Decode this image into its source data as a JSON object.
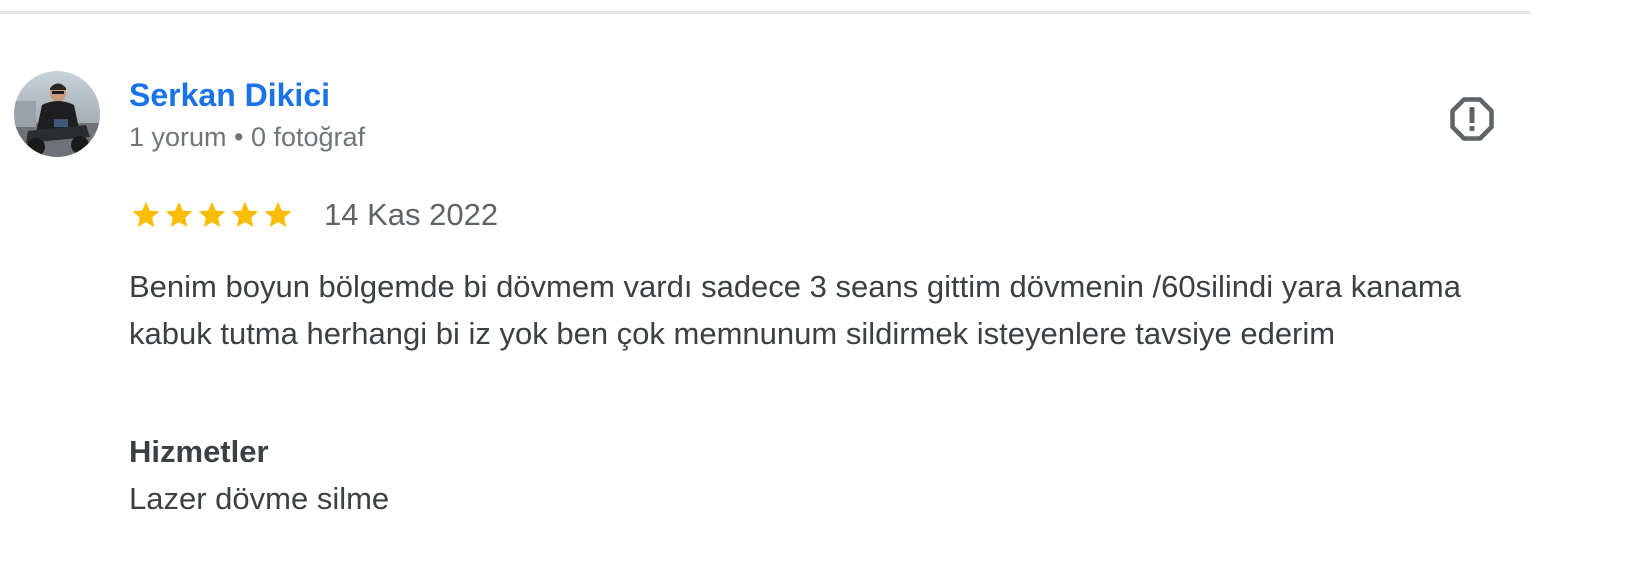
{
  "review": {
    "reviewer_name": "Serkan Dikici",
    "reviewer_meta": "1 yorum • 0 fotoğraf",
    "rating": 5,
    "rating_max": 5,
    "date": "14 Kas 2022",
    "text": "Benim boyun bölgemde bi dövmem vardı sadece 3 seans gittim dövmenin /60silindi yara kanama kabuk tutma herhangi bi iz yok ben çok memnunum sildirmek isteyenlere tavsiye ederim",
    "services_heading": "Hizmetler",
    "services_value": "Lazer dövme silme"
  },
  "icons": {
    "report": "report-flag-icon",
    "star": "star-icon"
  },
  "colors": {
    "name_link": "#1a73e8",
    "star": "#fbbc04",
    "icon": "#5f6368",
    "text": "#3c4043",
    "meta": "#70757a"
  }
}
